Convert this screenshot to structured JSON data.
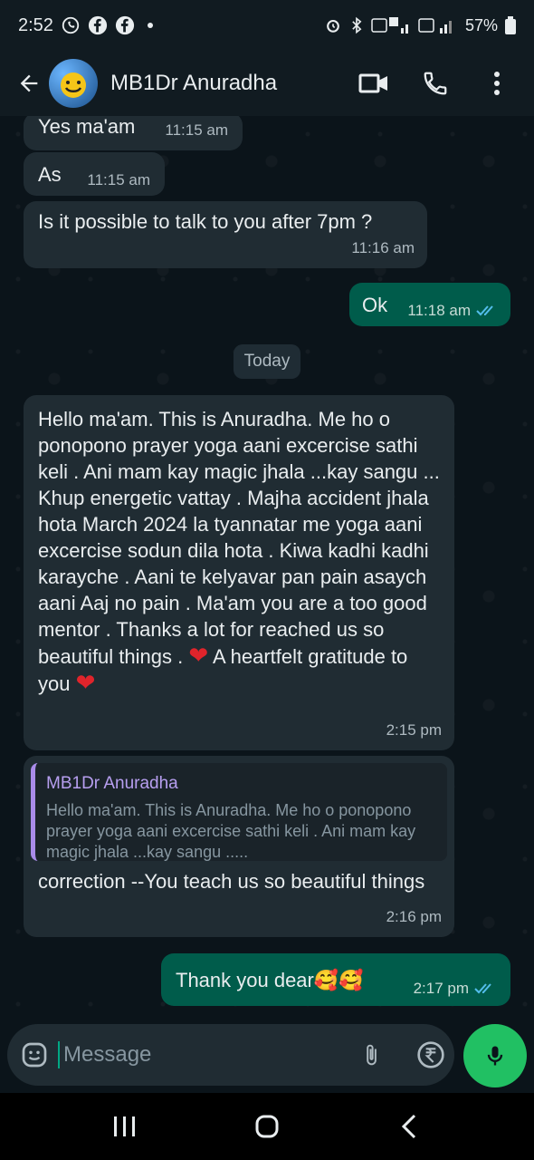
{
  "status_bar": {
    "time": "2:52",
    "battery": "57%"
  },
  "header": {
    "contact_name": "MB1Dr Anuradha"
  },
  "messages": [
    {
      "text": "Yes ma'am",
      "time": "11:15 am"
    },
    {
      "text": "As",
      "time": "11:15 am"
    },
    {
      "text": "Is it possible to talk to you after 7pm ?",
      "time": "11:16 am"
    },
    {
      "text": "Ok",
      "time": "11:18 am"
    },
    {
      "text_part1": "Hello ma'am. This is Anuradha. Me ho o ponopono prayer yoga aani excercise sathi keli . Ani mam kay magic jhala ...kay sangu ... Khup energetic vattay . Majha accident jhala hota March 2024 la tyannatar me yoga aani excercise sodun dila hota . Kiwa kadhi kadhi karayche . Aani te kelyavar pan pain asaych aani Aaj no pain . Ma'am you are a too good mentor . Thanks a lot for reached us so beautiful things . ",
      "text_part2": " A heartfelt gratitude to you ",
      "time": "2:15 pm"
    },
    {
      "quote_name": "MB1Dr Anuradha",
      "quote_text": "Hello ma'am. This is Anuradha. Me ho o ponopono prayer yoga aani excercise sathi keli . Ani mam kay magic jhala ...kay sangu .....",
      "text": "correction --You teach us so beautiful things",
      "time": "2:16 pm"
    },
    {
      "text": "Thank you dear",
      "emoji": "🥰🥰",
      "time": "2:17 pm"
    }
  ],
  "date_separator": "Today",
  "composer": {
    "placeholder": "Message"
  },
  "colors": {
    "incoming_bubble": "#202c33",
    "outgoing_bubble": "#005c4b",
    "accent": "#21c063",
    "read_ticks": "#53bdeb"
  },
  "icons": [
    "back-arrow-icon",
    "video-call-icon",
    "voice-call-icon",
    "more-options-icon",
    "emoji-icon",
    "attach-icon",
    "rupee-payment-icon",
    "camera-icon",
    "mic-icon",
    "recents-icon",
    "home-icon",
    "back-icon"
  ]
}
